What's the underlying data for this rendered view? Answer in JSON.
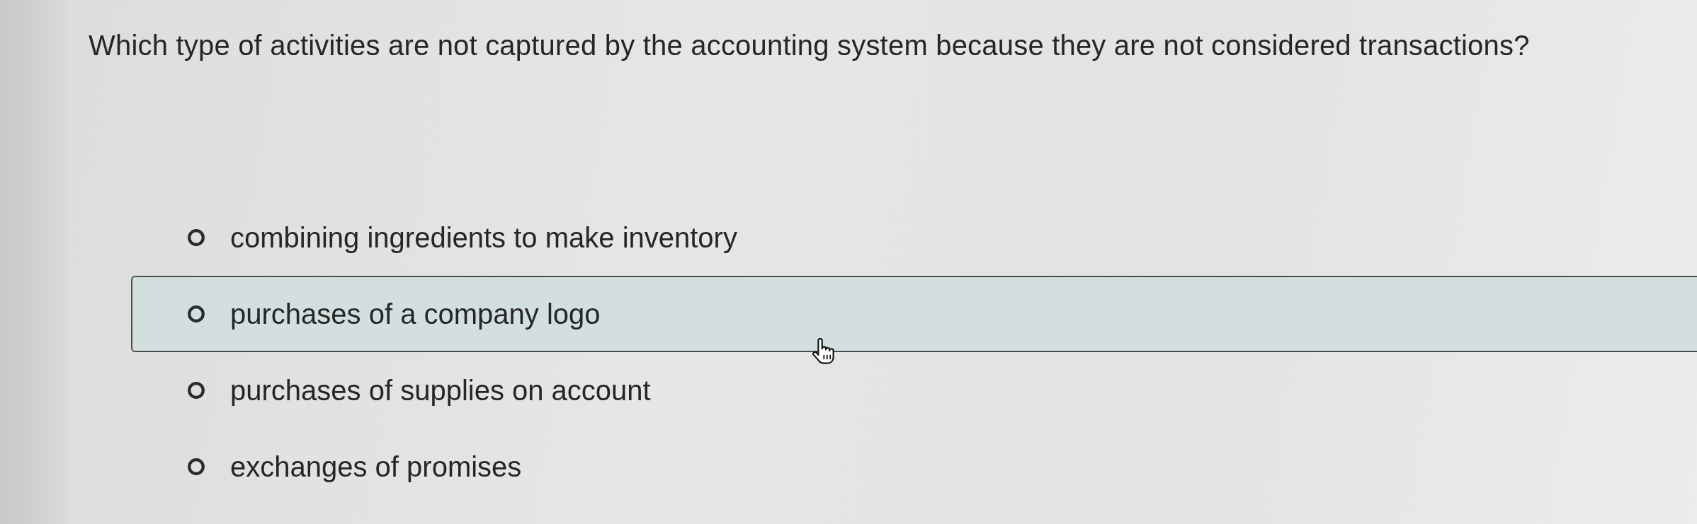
{
  "question": {
    "text": "Which type of activities are not captured by the accounting system because they are not considered transactions?"
  },
  "options": [
    {
      "label": "combining ingredients to make inventory",
      "selected": false,
      "hovered": false
    },
    {
      "label": "purchases of a company logo",
      "selected": false,
      "hovered": true
    },
    {
      "label": "purchases of supplies on account",
      "selected": false,
      "hovered": false
    },
    {
      "label": "exchanges of promises",
      "selected": false,
      "hovered": false
    }
  ]
}
